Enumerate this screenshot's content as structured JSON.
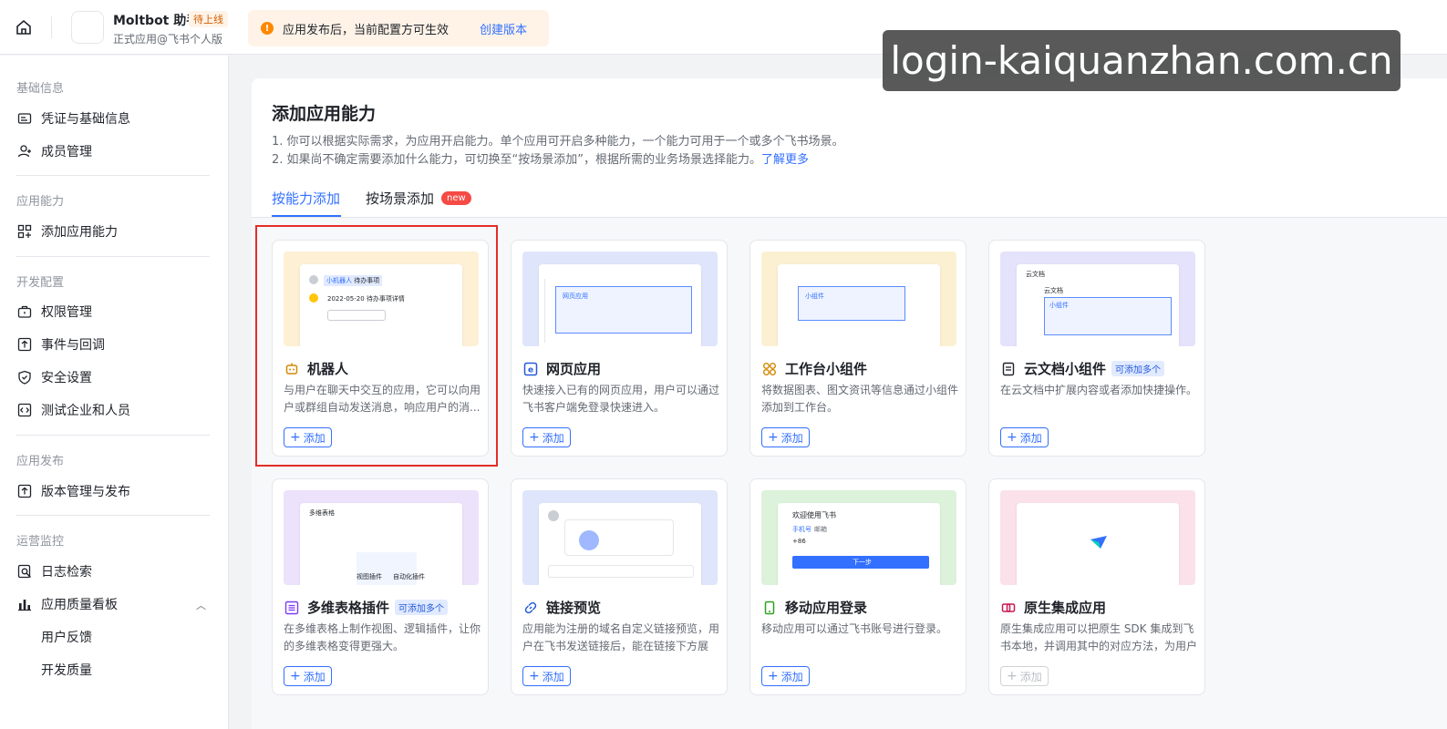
{
  "header": {
    "app_name": "Moltbot 助手",
    "app_status": "待上线",
    "app_subtitle": "正式应用@飞书个人版",
    "notice_text": "应用发布后，当前配置方可生效",
    "notice_link": "创建版本",
    "watermark": "login-kaiquanzhan.com.cn"
  },
  "sidebar": {
    "sections": [
      {
        "title": "基础信息",
        "items": [
          "凭证与基础信息",
          "成员管理"
        ]
      },
      {
        "title": "应用能力",
        "items": [
          "添加应用能力"
        ]
      },
      {
        "title": "开发配置",
        "items": [
          "权限管理",
          "事件与回调",
          "安全设置",
          "测试企业和人员"
        ]
      },
      {
        "title": "应用发布",
        "items": [
          "版本管理与发布"
        ]
      },
      {
        "title": "运营监控",
        "items": [
          "日志检索",
          "应用质量看板",
          "用户反馈",
          "开发质量"
        ]
      }
    ]
  },
  "main": {
    "title": "添加应用能力",
    "desc1": "1. 你可以根据实际需求，为应用开启能力。单个应用可开启多种能力，一个能力可用于一个或多个飞书场景。",
    "desc2": "2. 如果尚不确定需要添加什么能力，可切换至“按场景添加”，根据所需的业务场景选择能力。",
    "desc2_link": "了解更多",
    "tabs": [
      "按能力添加",
      "按场景添加"
    ],
    "tab_badge": "new",
    "add_label": "添加",
    "cards": [
      {
        "title": "机器人",
        "tag": "",
        "desc": "与用户在聊天中交互的应用，它可以向用户或群组自动发送消息，响应用户的消...",
        "icon": "robot-icon",
        "thumb_color": "#fdf0d5"
      },
      {
        "title": "网页应用",
        "tag": "",
        "desc": "快速接入已有的网页应用，用户可以通过飞书客户端免登录快速进入。",
        "icon": "web-app-icon",
        "thumb_color": "#dfe6fb"
      },
      {
        "title": "工作台小组件",
        "tag": "",
        "desc": "将数据图表、图文资讯等信息通过小组件添加到工作台。",
        "icon": "widget-icon",
        "thumb_color": "#fbf1d2"
      },
      {
        "title": "云文档小组件",
        "tag": "可添加多个",
        "desc": "在云文档中扩展内容或者添加快捷操作。",
        "icon": "doc-icon",
        "thumb_color": "#e4e3fb"
      },
      {
        "title": "多维表格插件",
        "tag": "可添加多个",
        "desc": "在多维表格上制作视图、逻辑插件，让你的多维表格变得更强大。",
        "icon": "table-icon",
        "thumb_color": "#ece2fb"
      },
      {
        "title": "链接预览",
        "tag": "",
        "desc": "应用能为注册的域名自定义链接预览，用户在飞书发送链接后，能在链接下方展示...",
        "icon": "link-icon",
        "thumb_color": "#dfe6fb"
      },
      {
        "title": "移动应用登录",
        "tag": "",
        "desc": "移动应用可以通过飞书账号进行登录。",
        "icon": "mobile-icon",
        "thumb_color": "#dcf2db"
      },
      {
        "title": "原生集成应用",
        "tag": "",
        "desc": "原生集成应用可以把原生 SDK 集成到飞书本地，并调用其中的对应方法，为用户提...",
        "icon": "native-icon",
        "thumb_color": "#fbe1ea",
        "disabled": true
      }
    ],
    "thumb_texts": {
      "bot_chat": "小机器人",
      "bot_todo": "待办事项",
      "bot_date": "2022-05-20",
      "bot_detail": "待办事项详情",
      "web_app": "网页应用",
      "widget": "小组件",
      "cloud_doc": "云文档",
      "doc_widget": "小组件",
      "multi_table": "多维表格",
      "view_plugin": "视图插件",
      "auto_plugin": "自动化插件",
      "welcome": "欢迎使用飞书",
      "phone": "手机号",
      "email": "邮箱",
      "country_code": "+86",
      "next_step": "下一步"
    }
  },
  "colors": {
    "accent": "#3370ff",
    "highlight": "#e22e28",
    "warning": "#ff8800"
  }
}
